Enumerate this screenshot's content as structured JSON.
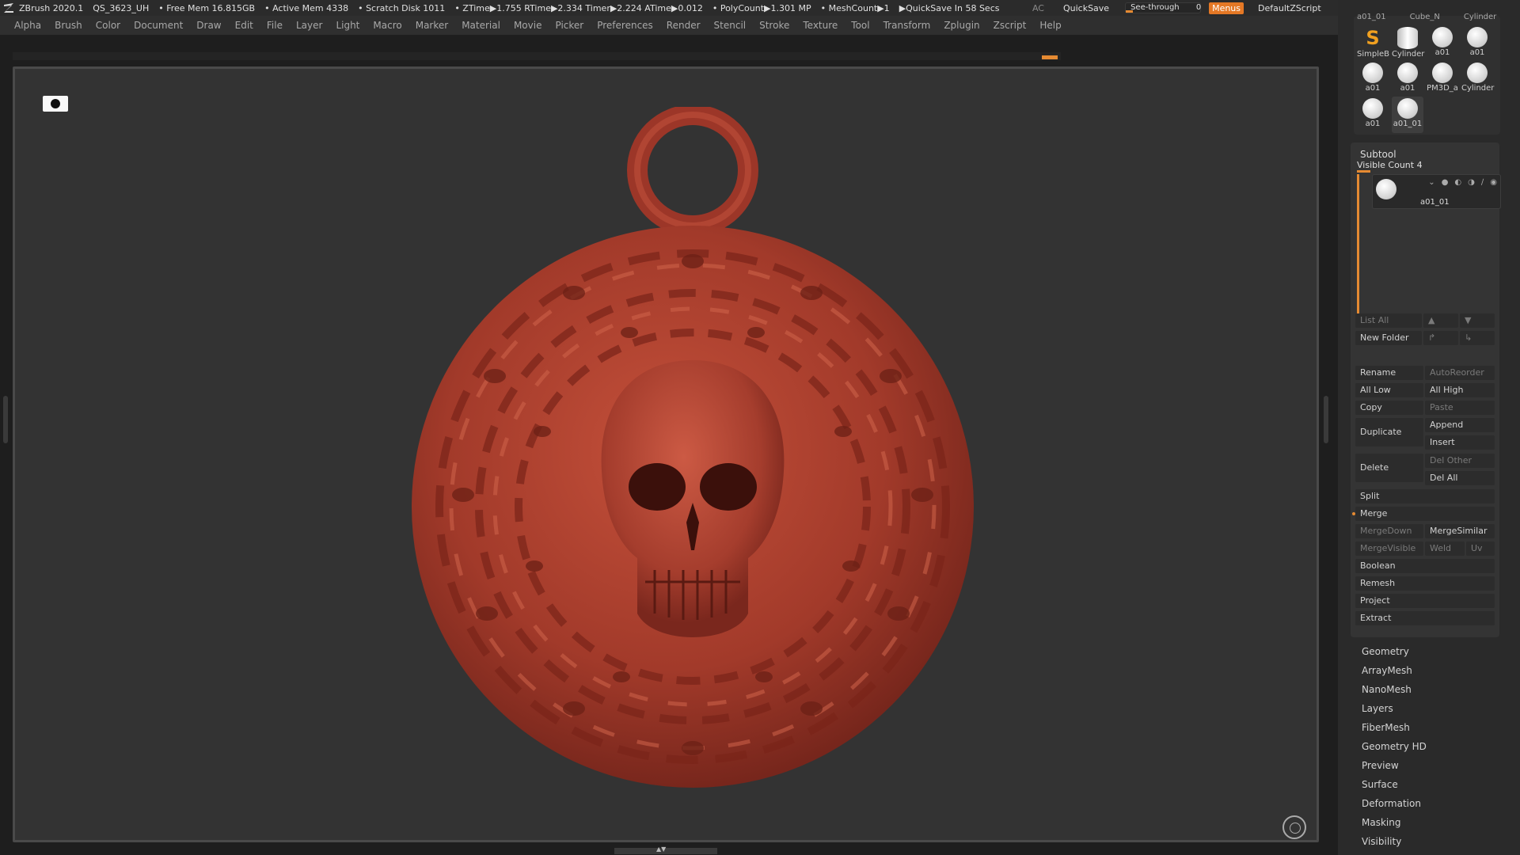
{
  "statusbar": {
    "app": "ZBrush 2020.1",
    "file": "QS_3623_UH",
    "free_mem": "• Free Mem 16.815GB",
    "active_mem": "• Active Mem 4338",
    "scratch": "• Scratch Disk 1011",
    "timing": "• ZTime▶1.755 RTime▶2.334 Timer▶2.224 ATime▶0.012",
    "polycount": "• PolyCount▶1.301 MP",
    "meshcount": "• MeshCount▶1",
    "quicksave_timer": "▶QuickSave In 58 Secs",
    "ac": "AC",
    "quicksave": "QuickSave",
    "see_through_label": "See-through",
    "see_through_value": "0",
    "menus": "Menus",
    "script": "DefaultZScript"
  },
  "menubar": [
    "Alpha",
    "Brush",
    "Color",
    "Document",
    "Draw",
    "Edit",
    "File",
    "Layer",
    "Light",
    "Macro",
    "Marker",
    "Material",
    "Movie",
    "Picker",
    "Preferences",
    "Render",
    "Stencil",
    "Stroke",
    "Texture",
    "Tool",
    "Transform",
    "Zplugin",
    "Zscript",
    "Help"
  ],
  "tool_thumbs": {
    "top_row_labels": [
      "a01_01",
      "Cube_N",
      "Cylinder"
    ],
    "row1": [
      "SimpleB",
      "Cylinder",
      "a01",
      "a01"
    ],
    "row2": [
      "a01",
      "a01",
      "PM3D_a",
      "Cylinder"
    ],
    "row3": [
      "a01",
      "a01_01"
    ]
  },
  "subtool": {
    "title": "Subtool",
    "visible_count": "Visible Count 4",
    "visible_count_level": 0.1,
    "item_name": "a01_01",
    "list_all": "List All",
    "new_folder": "New Folder",
    "rename": "Rename",
    "auto_reorder": "AutoReorder",
    "all_low": "All Low",
    "all_high": "All High",
    "copy": "Copy",
    "paste": "Paste",
    "duplicate": "Duplicate",
    "append": "Append",
    "insert": "Insert",
    "delete": "Delete",
    "del_other": "Del Other",
    "del_all": "Del All",
    "split": "Split",
    "merge": "Merge",
    "merge_down": "MergeDown",
    "merge_similar": "MergeSimilar",
    "merge_visible": "MergeVisible",
    "weld": "Weld",
    "uv": "Uv",
    "boolean": "Boolean",
    "remesh": "Remesh",
    "project": "Project",
    "extract": "Extract"
  },
  "palette_items": [
    "Geometry",
    "ArrayMesh",
    "NanoMesh",
    "Layers",
    "FiberMesh",
    "Geometry HD",
    "Preview",
    "Surface",
    "Deformation",
    "Masking",
    "Visibility"
  ],
  "colors": {
    "accent": "#e58a32",
    "clay": "#a13a2b",
    "canvas": "#333333"
  }
}
